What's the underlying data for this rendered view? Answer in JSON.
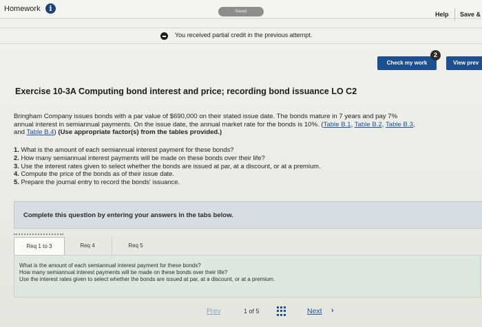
{
  "header": {
    "title": "Homework",
    "saved_label": "Saved",
    "help_label": "Help",
    "save_exit_label": "Save &"
  },
  "notice": {
    "text": "You received partial credit in the previous attempt."
  },
  "actions": {
    "check_label": "Check my work",
    "check_badge": "2",
    "view_label": "View prev"
  },
  "exercise": {
    "title": "Exercise 10-3A Computing bond interest and price; recording bond issuance LO C2",
    "problem_line1": "Bringham Company issues bonds with a par value of $690,000 on their stated issue date. The bonds mature in 7 years and pay 7%",
    "problem_line2": "annual interest in semiannual payments. On the issue date, the annual market rate for the bonds is 10%.",
    "link_b1": "Table B.1",
    "link_b2": "Table B.2",
    "link_b3": "Table B.3",
    "link_and": "and",
    "link_b4": "Table B.4",
    "problem_bold": "(Use appropriate factor(s) from the tables provided.)",
    "questions": [
      {
        "num": "1.",
        "text": "What is the amount of each semiannual interest payment for these bonds?"
      },
      {
        "num": "2.",
        "text": "How many semiannual interest payments will be made on these bonds over their life?"
      },
      {
        "num": "3.",
        "text": "Use the interest rates given to select whether the bonds are issued at par, at a discount, or at a premium."
      },
      {
        "num": "4.",
        "text": "Compute the price of the bonds as of their issue date."
      },
      {
        "num": "5.",
        "text": "Prepare the journal entry to record the bonds' issuance."
      }
    ]
  },
  "complete_box": {
    "text": "Complete this question by entering your answers in the tabs below."
  },
  "tabs": [
    {
      "label": "Req 1 to 3"
    },
    {
      "label": "Req 4"
    },
    {
      "label": "Req 5"
    }
  ],
  "tab_content": {
    "lines": [
      "What is the amount of each semiannual interest payment for these bonds?",
      "How many semiannual interest payments will be made on these bonds over their life?",
      "Use the interest rates given to select whether the bonds are issued at par, at a discount, or at a premium."
    ]
  },
  "pager": {
    "prev_label": "Prev",
    "page_info": "1 of 5",
    "next_label": "Next"
  }
}
